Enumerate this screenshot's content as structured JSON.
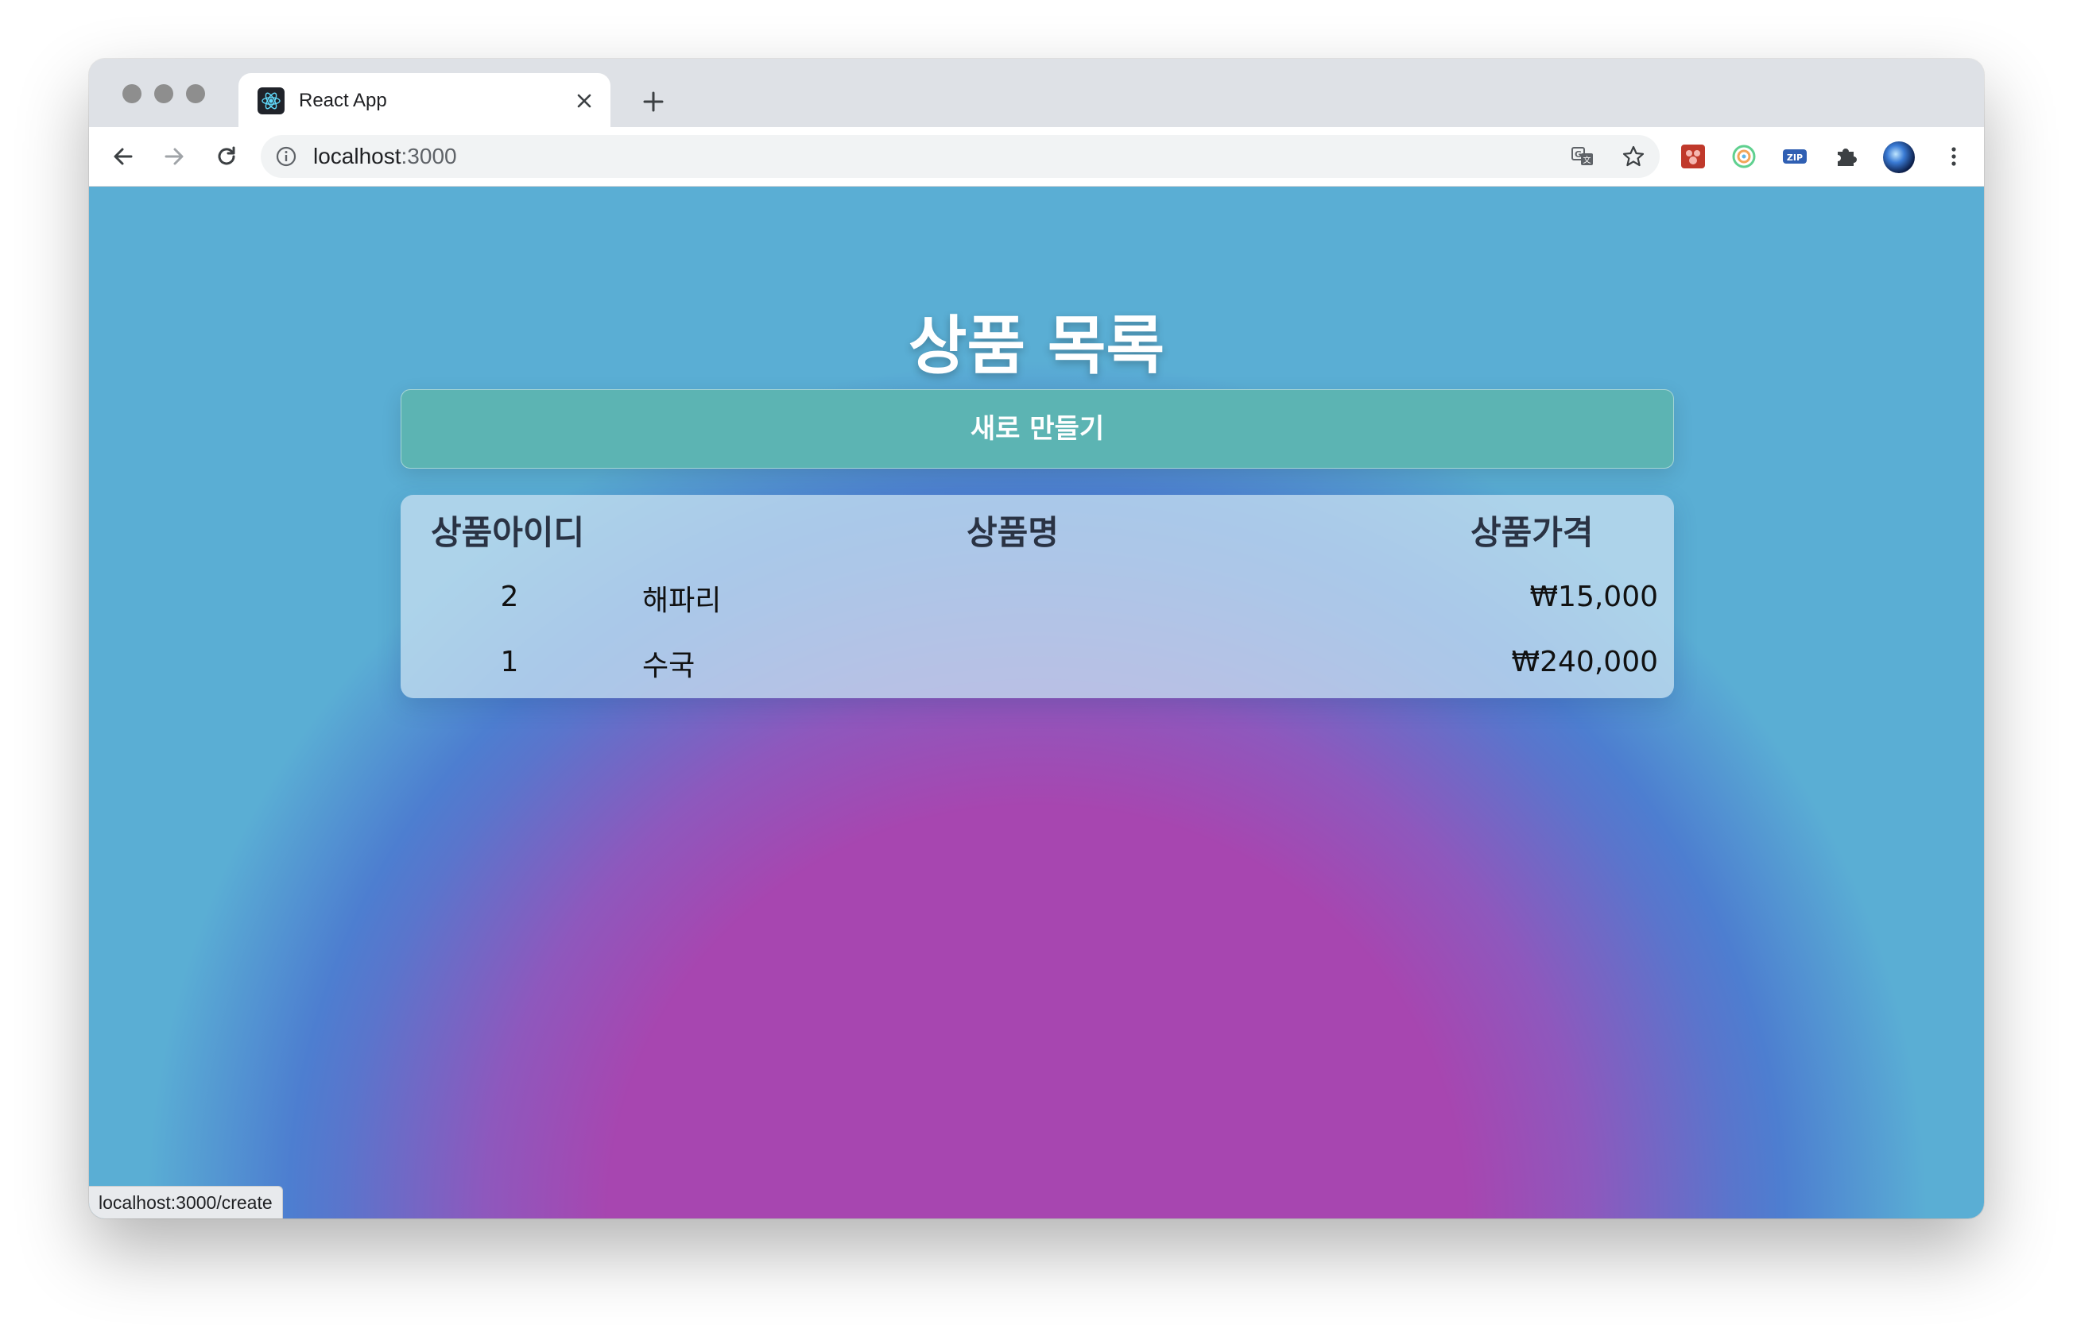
{
  "browser": {
    "tab_title": "React App",
    "url_host": "localhost",
    "url_port": ":3000",
    "status_url": "localhost:3000/create"
  },
  "page": {
    "title": "상품 목록",
    "create_button_label": "새로 만들기",
    "table": {
      "headers": {
        "id": "상품아이디",
        "name": "상품명",
        "price": "상품가격"
      },
      "rows": [
        {
          "id": "2",
          "name": "해파리",
          "price": "₩15,000"
        },
        {
          "id": "1",
          "name": "수국",
          "price": "₩240,000"
        }
      ]
    }
  },
  "colors": {
    "gradient_center": "#a746b0",
    "gradient_edge": "#5aaed4",
    "button": "#5cb4b3",
    "heading_text": "#ffffff"
  }
}
